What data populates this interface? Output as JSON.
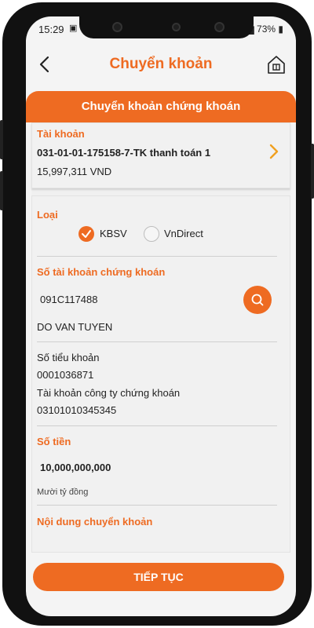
{
  "status_bar": {
    "time": "15:29",
    "left_icons": "▣ ◔ ·",
    "battery": "73%"
  },
  "header": {
    "title": "Chuyển khoản"
  },
  "tab": {
    "label": "Chuyển khoản chứng khoán"
  },
  "account_card": {
    "label": "Tài khoản",
    "account_name": "031-01-01-175158-7-TK thanh toán 1",
    "balance": "15,997,311 VND"
  },
  "type_section": {
    "label": "Loại",
    "options": [
      {
        "label": "KBSV",
        "selected": true
      },
      {
        "label": "VnDirect",
        "selected": false
      }
    ]
  },
  "securities_account": {
    "label": "Số tài khoản chứng khoán",
    "account_number": "091C117488",
    "holder_name": "DO VAN TUYEN"
  },
  "sub_account": {
    "label": "Số tiểu khoản",
    "value": "0001036871",
    "company_account_label": "Tài khoản công ty chứng khoán",
    "company_account_value": "03101010345345"
  },
  "amount": {
    "label": "Số tiền",
    "value": "10,000,000,000",
    "in_words": "Mười tỷ đồng"
  },
  "transfer_content": {
    "label": "Nội dung chuyển khoản"
  },
  "actions": {
    "continue_label": "TIẾP TỤC"
  },
  "colors": {
    "accent": "#ee6b22",
    "chevron": "#f0a020"
  }
}
